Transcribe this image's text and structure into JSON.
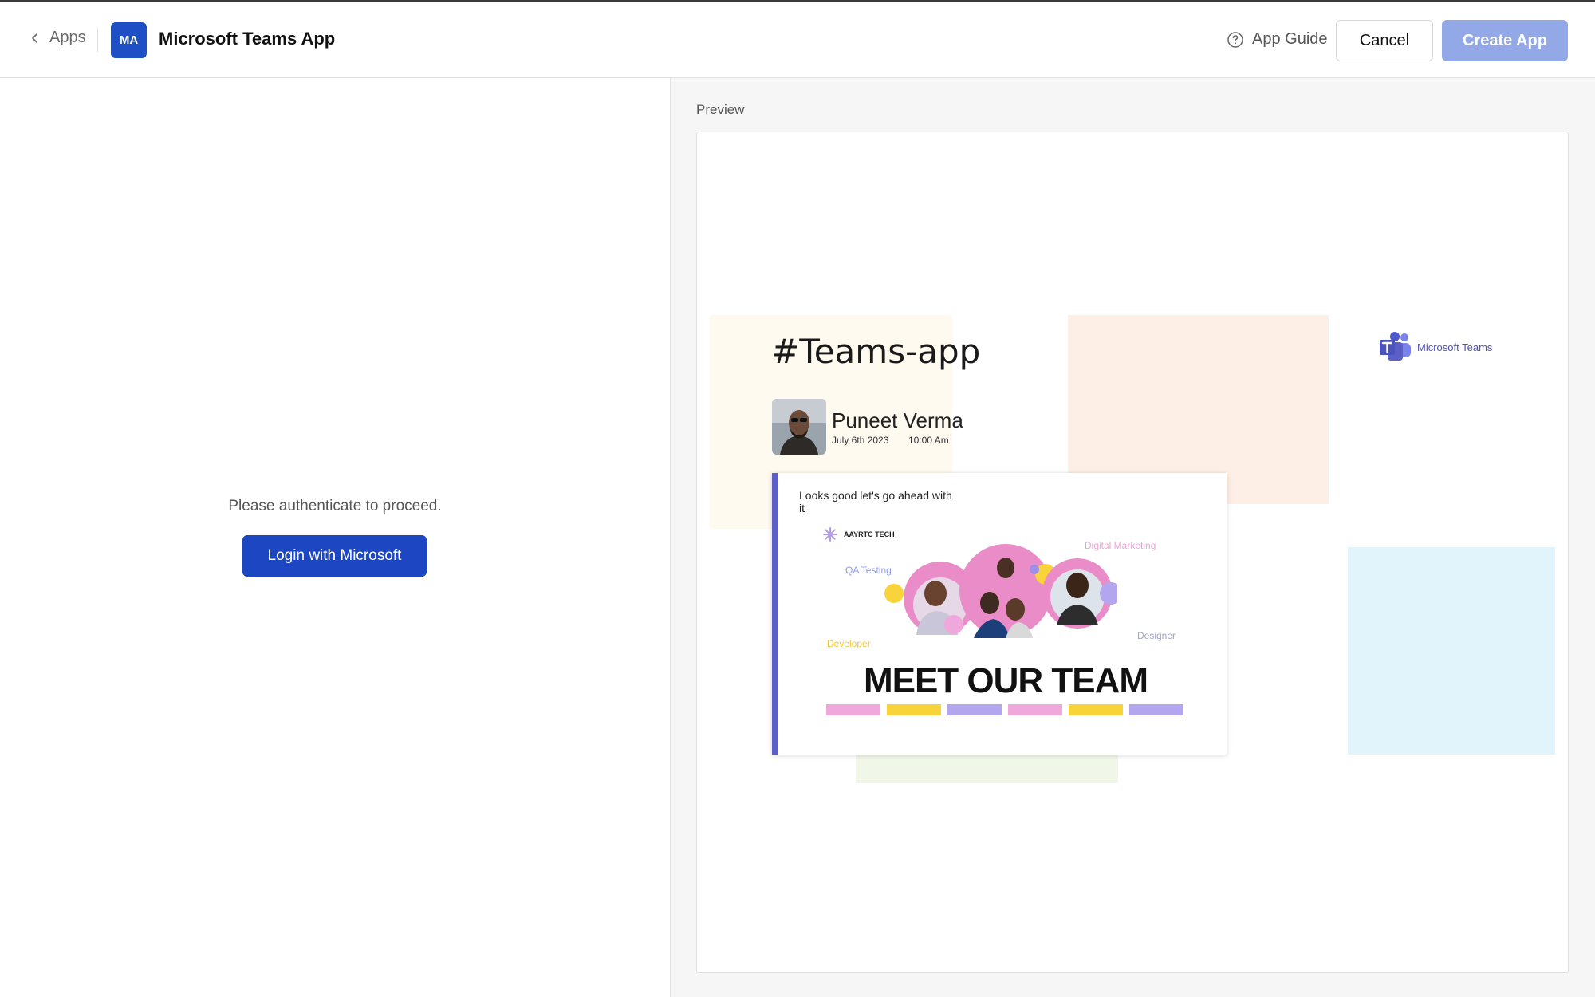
{
  "header": {
    "back_label": "Apps",
    "app_initials": "MA",
    "app_title": "Microsoft Teams App",
    "guide_label": "App Guide",
    "cancel_label": "Cancel",
    "create_label": "Create App"
  },
  "auth": {
    "message": "Please authenticate to proceed.",
    "login_label": "Login with Microsoft"
  },
  "preview": {
    "label": "Preview",
    "channel": "#Teams-app",
    "teams_logo_text": "Microsoft Teams",
    "poster": {
      "name": "Puneet Verma",
      "date": "July 6th 2023",
      "time": "10:00 Am"
    },
    "card": {
      "message": "Looks good let's go ahead with it",
      "brand": "AAYRTC TECH",
      "roles": {
        "digital_marketing": "Digital Marketing",
        "qa_testing": "QA Testing",
        "developer": "Developer",
        "designer": "Designer"
      },
      "headline": "MEET OUR TEAM",
      "bar_colors": [
        "#f0a8dc",
        "#f8d43a",
        "#b3a6ee",
        "#f0a8dc",
        "#f8d43a",
        "#b3a6ee"
      ]
    }
  },
  "colors": {
    "brand_blue": "#1d47c2",
    "create_disabled": "#93a8e6",
    "teams_purple": "#5b5fc7"
  }
}
